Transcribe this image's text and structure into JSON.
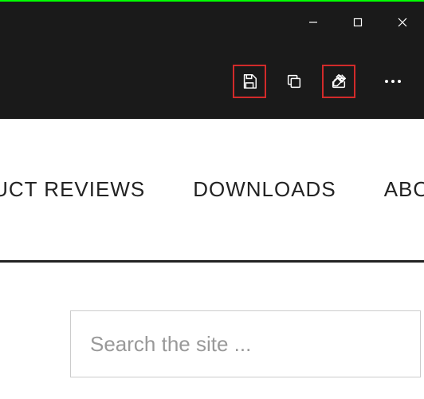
{
  "window": {
    "minimize_icon": "minimize-icon",
    "maximize_icon": "maximize-icon",
    "close_icon": "close-icon"
  },
  "toolbar": {
    "save_icon": "save-icon",
    "copy_icon": "copy-icon",
    "share_icon": "share-icon",
    "more_icon": "more-icon"
  },
  "nav": {
    "items": [
      {
        "label": "PRODUCT REVIEWS"
      },
      {
        "label": "DOWNLOADS"
      },
      {
        "label": "ABOUT"
      }
    ]
  },
  "search": {
    "placeholder": "Search the site ..."
  },
  "colors": {
    "highlight": "#d22a2a",
    "dark_bg": "#1a1a1a",
    "top_accent": "#00ff00"
  }
}
